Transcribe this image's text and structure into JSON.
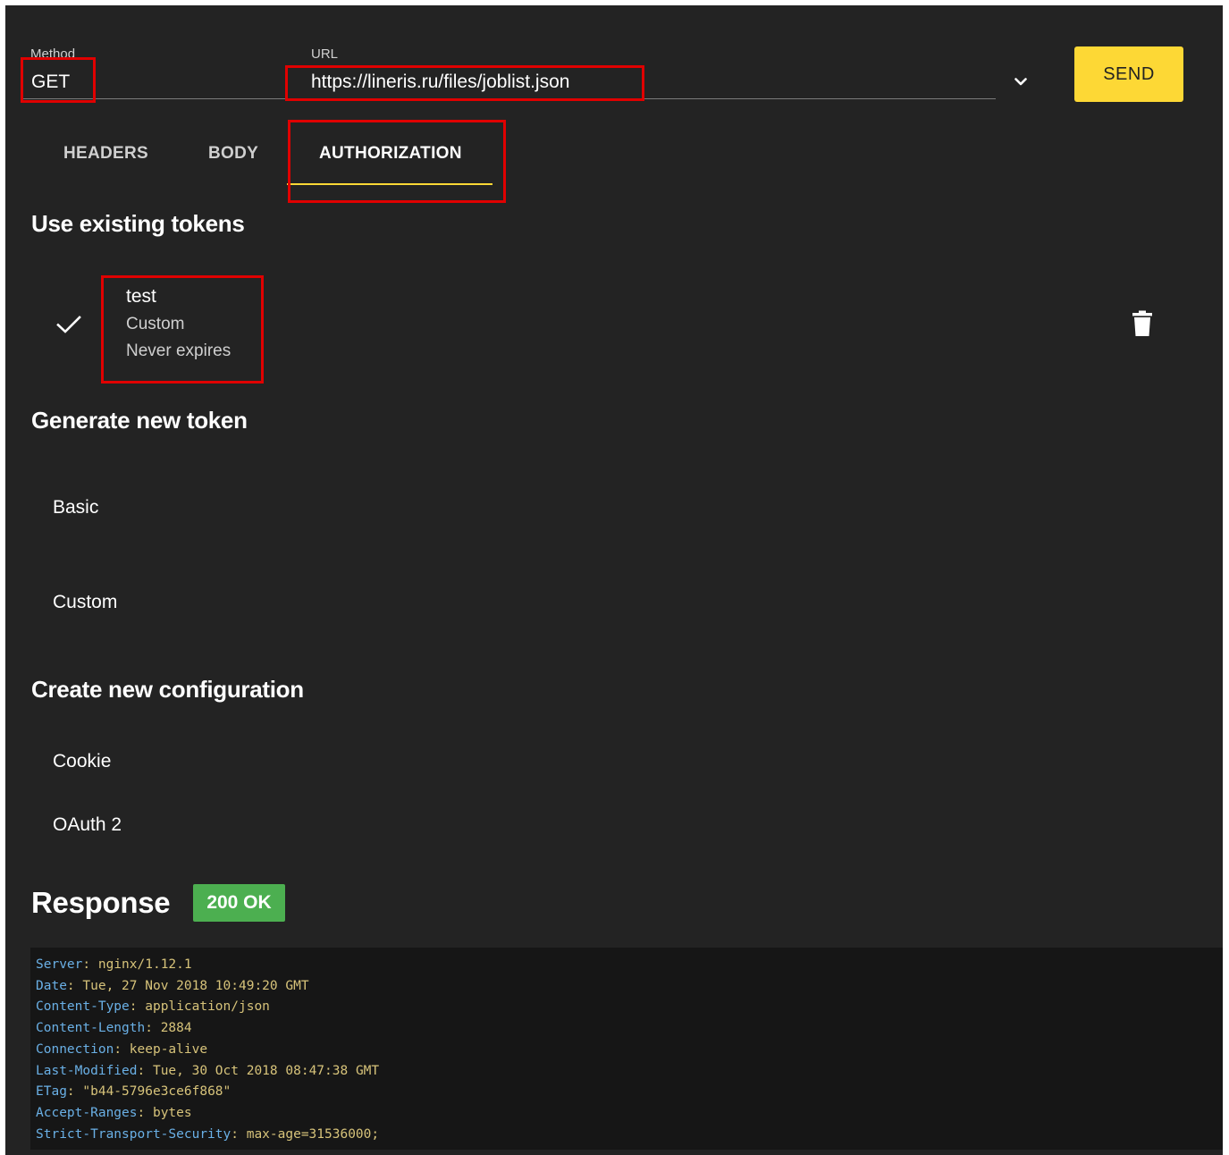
{
  "request": {
    "method_label": "Method",
    "method": "GET",
    "url_label": "URL",
    "url": "https://lineris.ru/files/joblist.json",
    "send_label": "SEND"
  },
  "tabs": [
    {
      "label": "HEADERS",
      "active": false
    },
    {
      "label": "BODY",
      "active": false
    },
    {
      "label": "AUTHORIZATION",
      "active": true
    }
  ],
  "existing_tokens": {
    "title": "Use existing tokens",
    "tokens": [
      {
        "name": "test",
        "type": "Custom",
        "expiry": "Never expires",
        "selected": true
      }
    ]
  },
  "generate_token": {
    "title": "Generate new token",
    "items": [
      "Basic",
      "Custom"
    ]
  },
  "create_config": {
    "title": "Create new configuration",
    "items": [
      "Cookie",
      "OAuth 2"
    ]
  },
  "response": {
    "title": "Response",
    "status": "200 OK",
    "headers": [
      {
        "key": "Server",
        "value": "nginx/1.12.1"
      },
      {
        "key": "Date",
        "value": "Tue, 27 Nov 2018 10:49:20 GMT"
      },
      {
        "key": "Content-Type",
        "value": "application/json"
      },
      {
        "key": "Content-Length",
        "value": "2884"
      },
      {
        "key": "Connection",
        "value": "keep-alive"
      },
      {
        "key": "Last-Modified",
        "value": "Tue, 30 Oct 2018 08:47:38 GMT"
      },
      {
        "key": "ETag",
        "value": "\"b44-5796e3ce6f868\""
      },
      {
        "key": "Accept-Ranges",
        "value": "bytes"
      },
      {
        "key": "Strict-Transport-Security",
        "value": "max-age=31536000;"
      }
    ]
  },
  "colors": {
    "background": "#232323",
    "accent": "#fdd835",
    "status_ok": "#4caf50",
    "highlight": "#e00000"
  },
  "icons": {
    "url_dropdown": "chevron-down-icon",
    "token_selected": "check-icon",
    "token_delete": "trash-icon"
  }
}
